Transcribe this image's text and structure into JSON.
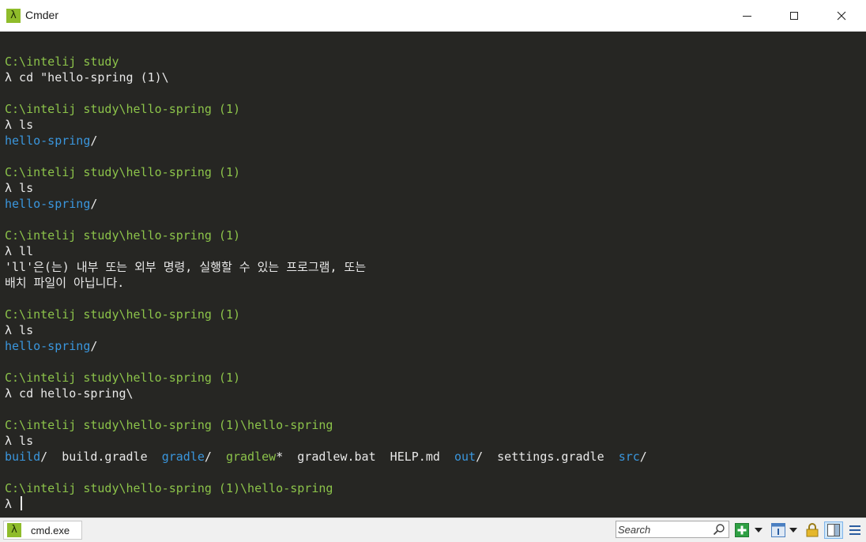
{
  "window": {
    "title": "Cmder",
    "app_icon": "λ"
  },
  "terminal": {
    "lines": [
      {
        "parts": []
      },
      {
        "parts": [
          {
            "t": "C:\\intelij study",
            "c": "path"
          }
        ]
      },
      {
        "parts": [
          {
            "t": "λ cd \"hello-spring (1)\\",
            "c": ""
          }
        ]
      },
      {
        "parts": []
      },
      {
        "parts": [
          {
            "t": "C:\\intelij study\\hello-spring (1)",
            "c": "path"
          }
        ]
      },
      {
        "parts": [
          {
            "t": "λ ls",
            "c": ""
          }
        ]
      },
      {
        "parts": [
          {
            "t": "hello-spring",
            "c": "dir"
          },
          {
            "t": "/",
            "c": ""
          }
        ]
      },
      {
        "parts": []
      },
      {
        "parts": [
          {
            "t": "C:\\intelij study\\hello-spring (1)",
            "c": "path"
          }
        ]
      },
      {
        "parts": [
          {
            "t": "λ ls",
            "c": ""
          }
        ]
      },
      {
        "parts": [
          {
            "t": "hello-spring",
            "c": "dir"
          },
          {
            "t": "/",
            "c": ""
          }
        ]
      },
      {
        "parts": []
      },
      {
        "parts": [
          {
            "t": "C:\\intelij study\\hello-spring (1)",
            "c": "path"
          }
        ]
      },
      {
        "parts": [
          {
            "t": "λ ll",
            "c": ""
          }
        ]
      },
      {
        "parts": [
          {
            "t": "'ll'은(는) 내부 또는 외부 명령, 실행할 수 있는 프로그램, 또는",
            "c": ""
          }
        ]
      },
      {
        "parts": [
          {
            "t": "배치 파일이 아닙니다.",
            "c": ""
          }
        ]
      },
      {
        "parts": []
      },
      {
        "parts": [
          {
            "t": "C:\\intelij study\\hello-spring (1)",
            "c": "path"
          }
        ]
      },
      {
        "parts": [
          {
            "t": "λ ls",
            "c": ""
          }
        ]
      },
      {
        "parts": [
          {
            "t": "hello-spring",
            "c": "dir"
          },
          {
            "t": "/",
            "c": ""
          }
        ]
      },
      {
        "parts": []
      },
      {
        "parts": [
          {
            "t": "C:\\intelij study\\hello-spring (1)",
            "c": "path"
          }
        ]
      },
      {
        "parts": [
          {
            "t": "λ cd hello-spring\\",
            "c": ""
          }
        ]
      },
      {
        "parts": []
      },
      {
        "parts": [
          {
            "t": "C:\\intelij study\\hello-spring (1)\\hello-spring",
            "c": "path"
          }
        ]
      },
      {
        "parts": [
          {
            "t": "λ ls",
            "c": ""
          }
        ]
      },
      {
        "parts": [
          {
            "t": "build",
            "c": "dir"
          },
          {
            "t": "/  build.gradle  ",
            "c": ""
          },
          {
            "t": "gradle",
            "c": "dir"
          },
          {
            "t": "/  ",
            "c": ""
          },
          {
            "t": "gradlew",
            "c": "exe"
          },
          {
            "t": "*  gradlew.bat  HELP.md  ",
            "c": ""
          },
          {
            "t": "out",
            "c": "dir"
          },
          {
            "t": "/  settings.gradle  ",
            "c": ""
          },
          {
            "t": "src",
            "c": "dir"
          },
          {
            "t": "/",
            "c": ""
          }
        ]
      },
      {
        "parts": []
      },
      {
        "parts": [
          {
            "t": "C:\\intelij study\\hello-spring (1)\\hello-spring",
            "c": "path"
          }
        ]
      },
      {
        "parts": [
          {
            "t": "λ ",
            "c": ""
          }
        ],
        "cursor": true
      }
    ]
  },
  "statusbar": {
    "tab_label": "cmd.exe",
    "tab_icon": "λ",
    "search_placeholder": "Search"
  },
  "icons": {
    "app": "lambda-icon",
    "minimize": "minimize-icon",
    "maximize": "maximize-icon",
    "close": "close-icon",
    "search": "search-icon",
    "new_console": "plus-icon",
    "console_list": "console-icon",
    "lock": "lock-icon",
    "split": "split-view-icon",
    "menu": "hamburger-menu-icon"
  },
  "colors": {
    "terminal_bg": "#262623",
    "path": "#8cc34a",
    "directory": "#3a96dd",
    "text": "#e8e8e8",
    "accent_green": "#8fbc2b"
  }
}
